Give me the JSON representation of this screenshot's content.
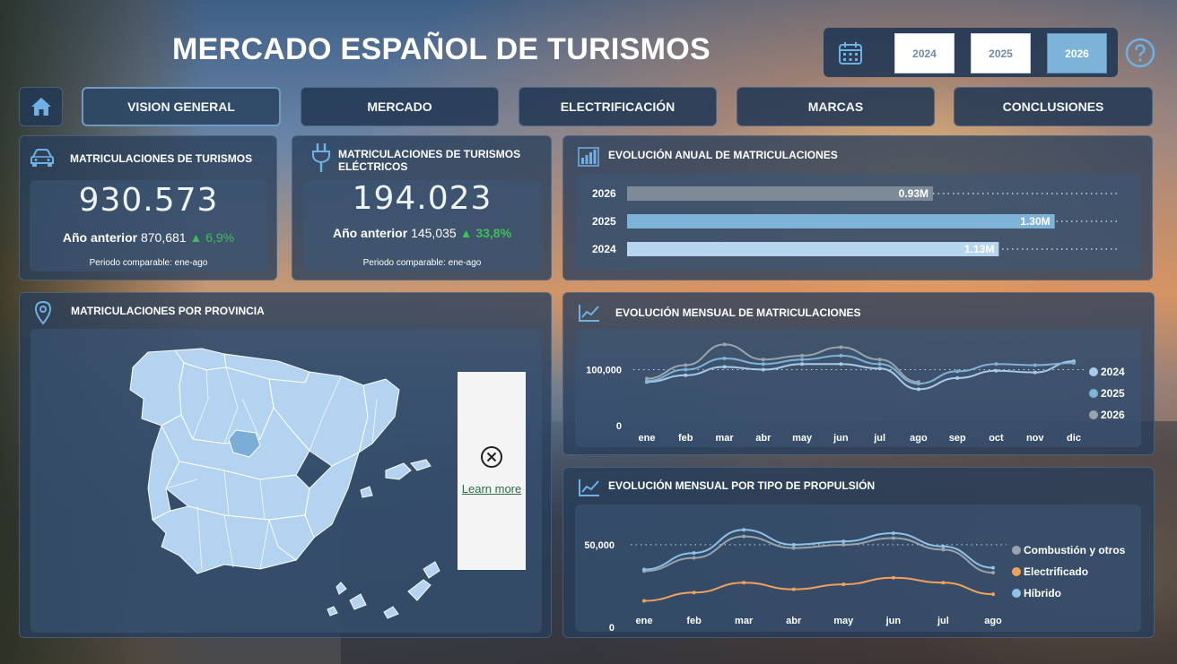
{
  "header": {
    "title": "MERCADO ESPAÑOL DE TURISMOS",
    "years": [
      "2024",
      "2025",
      "2026"
    ],
    "selected_year": "2026"
  },
  "nav": {
    "items": [
      "VISION GENERAL",
      "MERCADO",
      "ELECTRIFICACIÓN",
      "MARCAS",
      "CONCLUSIONES"
    ],
    "active": "VISION GENERAL"
  },
  "kpi_total": {
    "title": "MATRICULACIONES DE TURISMOS",
    "value": "930.573",
    "prev_label": "Año anterior",
    "prev_value": "870,681",
    "change": "6,9%",
    "note": "Periodo comparable: ene-ago"
  },
  "kpi_electric": {
    "title": "MATRICULACIONES DE TURISMOS ELÉCTRICOS",
    "value": "194.023",
    "prev_label": "Año anterior",
    "prev_value": "145,035",
    "change": "33,8%",
    "note": "Periodo comparable: ene-ago"
  },
  "map": {
    "title": "MATRICULACIONES POR PROVINCIA",
    "learn_more": "Learn more",
    "colors": {
      "fill": "#b3d3f0",
      "highlight": "#7aaed6",
      "border": "#ffffff"
    }
  },
  "chart_data": [
    {
      "type": "bar",
      "title": "EVOLUCIÓN ANUAL DE MATRICULACIONES",
      "orientation": "horizontal",
      "categories": [
        "2026",
        "2025",
        "2024"
      ],
      "values": [
        0.93,
        1.3,
        1.13
      ],
      "value_labels": [
        "0.93M",
        "1.30M",
        "1.13M"
      ],
      "unit": "M",
      "colors": [
        "#7d8b98",
        "#7eb3d9",
        "#b7d5ee"
      ]
    },
    {
      "type": "line",
      "title": "EVOLUCIÓN MENSUAL DE MATRICULACIONES",
      "categories": [
        "ene",
        "feb",
        "mar",
        "abr",
        "may",
        "jun",
        "jul",
        "ago",
        "sep",
        "oct",
        "nov",
        "dic"
      ],
      "ylim": [
        0,
        160000
      ],
      "yticks": [
        0,
        100000
      ],
      "ytick_labels": [
        "0",
        "100,000"
      ],
      "legend_position": "right",
      "series": [
        {
          "name": "2024",
          "color": "#a9cbe8",
          "values": [
            78000,
            90000,
            105000,
            100000,
            110000,
            110000,
            102000,
            65000,
            85000,
            98000,
            95000,
            115000
          ]
        },
        {
          "name": "2025",
          "color": "#7eb3d9",
          "values": [
            80000,
            100000,
            120000,
            110000,
            118000,
            125000,
            110000,
            75000,
            97000,
            110000,
            108000,
            112000
          ]
        },
        {
          "name": "2026",
          "color": "#9aa4ad",
          "values": [
            84000,
            108000,
            145000,
            118000,
            125000,
            140000,
            118000,
            78000,
            null,
            null,
            null,
            null
          ]
        }
      ]
    },
    {
      "type": "line",
      "title": "EVOLUCIÓN MENSUAL POR TIPO DE PROPULSIÓN",
      "categories": [
        "ene",
        "feb",
        "mar",
        "abr",
        "may",
        "jun",
        "jul",
        "ago"
      ],
      "ylim": [
        0,
        70000
      ],
      "yticks": [
        0,
        50000
      ],
      "ytick_labels": [
        "0",
        "50,000"
      ],
      "legend_position": "right",
      "series": [
        {
          "name": "Combustión y otros",
          "color": "#9aa4ad",
          "values": [
            34000,
            42000,
            55000,
            48000,
            50000,
            54000,
            47000,
            33000
          ]
        },
        {
          "name": "Electrificado",
          "color": "#f2a05a",
          "values": [
            16000,
            21000,
            27000,
            23000,
            26000,
            30000,
            27000,
            20000
          ]
        },
        {
          "name": "Híbrido",
          "color": "#8fc2e8",
          "values": [
            35000,
            45000,
            59000,
            50000,
            52000,
            57000,
            49000,
            36000
          ]
        }
      ]
    }
  ]
}
